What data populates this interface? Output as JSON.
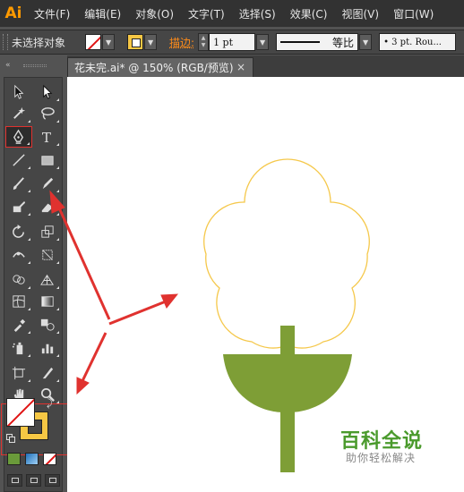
{
  "app": {
    "logo": "Ai"
  },
  "menu": [
    "文件(F)",
    "编辑(E)",
    "对象(O)",
    "文字(T)",
    "选择(S)",
    "效果(C)",
    "视图(V)",
    "窗口(W)"
  ],
  "control_bar": {
    "selection_status": "未选择对象",
    "fill_icon": "none-swatch",
    "stroke_icon": "stroke-swatch",
    "stroke_label": "描边:",
    "stroke_weight": "1 pt",
    "profile": "等比",
    "brush": "• 3 pt. Rou..."
  },
  "document_tab": {
    "title": "花未完.ai* @ 150% (RGB/预览)",
    "close": "×"
  },
  "tools": {
    "names": [
      "selection-tool",
      "direct-selection-tool",
      "magic-wand-tool",
      "lasso-tool",
      "pen-tool",
      "type-tool",
      "line-segment-tool",
      "rectangle-tool",
      "paintbrush-tool",
      "pencil-tool",
      "blob-brush-tool",
      "eraser-tool",
      "rotate-tool",
      "scale-tool",
      "width-tool",
      "free-transform-tool",
      "shape-builder-tool",
      "perspective-grid-tool",
      "mesh-tool",
      "gradient-tool",
      "eyedropper-tool",
      "blend-tool",
      "symbol-sprayer-tool",
      "column-graph-tool",
      "artboard-tool",
      "slice-tool",
      "hand-tool",
      "zoom-tool"
    ],
    "type_glyph": "T",
    "active": "pen-tool"
  },
  "colors": {
    "fill": "none",
    "stroke": "#f6c744",
    "flower_outline": "#f5c84b",
    "stem": "#7e9e36",
    "annotation": "#e0322f",
    "ui_dark": "#323232",
    "ui_mid": "#535353"
  },
  "watermark": {
    "title": "百科全说",
    "subtitle": "助你轻松解决"
  }
}
